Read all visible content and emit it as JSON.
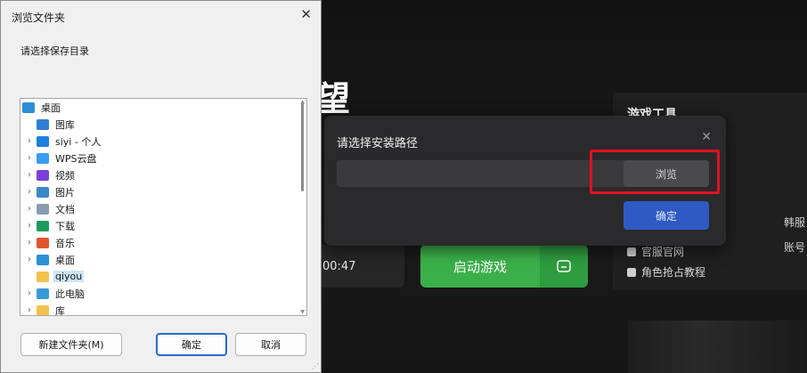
{
  "colors": {
    "accent_blue": "#2f5ac4",
    "start_green": "#3bb04a",
    "highlight_red": "#e0101e",
    "dialog_bg": "#2a2a2c",
    "windows_bg": "#f0f0f0"
  },
  "launcher": {
    "title_partial": "望",
    "time_partial": "00:47",
    "start_button": "启动游戏",
    "folder_icon": "folder-icon",
    "side_panel": {
      "title": "游戏工具",
      "items": [
        {
          "icon": "web-icon",
          "label": "官服官网"
        },
        {
          "icon": "doc-icon",
          "label": "角色抢占教程"
        }
      ],
      "links": [
        "韩服",
        "账号"
      ]
    }
  },
  "install_dialog": {
    "title": "请选择安装路径",
    "path_value": "",
    "browse_label": "浏览",
    "confirm_label": "确定"
  },
  "folder_dialog": {
    "title": "浏览文件夹",
    "prompt": "请选择保存目录",
    "tree": [
      {
        "label": "桌面",
        "icon": "desktop-icon",
        "color": "#2d8fd5",
        "level": 0,
        "expander": false
      },
      {
        "label": "图库",
        "icon": "gallery-icon",
        "color": "#2f7fd0",
        "level": 1,
        "expander": false
      },
      {
        "label": "siyi - 个人",
        "icon": "onedrive-icon",
        "color": "#1f7fdc",
        "level": 1,
        "expander": true
      },
      {
        "label": "WPS云盘",
        "icon": "cloud-icon",
        "color": "#3a9cf0",
        "level": 1,
        "expander": true
      },
      {
        "label": "视频",
        "icon": "video-icon",
        "color": "#7b3fd8",
        "level": 1,
        "expander": true
      },
      {
        "label": "图片",
        "icon": "pictures-icon",
        "color": "#3a86c8",
        "level": 1,
        "expander": true
      },
      {
        "label": "文档",
        "icon": "documents-icon",
        "color": "#8a9bb0",
        "level": 1,
        "expander": true
      },
      {
        "label": "下载",
        "icon": "download-icon",
        "color": "#1d9a5b",
        "level": 1,
        "expander": true
      },
      {
        "label": "音乐",
        "icon": "music-icon",
        "color": "#e0552e",
        "level": 1,
        "expander": true
      },
      {
        "label": "桌面",
        "icon": "desktop-icon",
        "color": "#2d8fd5",
        "level": 1,
        "expander": true
      },
      {
        "label": "qiyou",
        "icon": "folder-icon",
        "color": "#f2c14e",
        "level": 1,
        "expander": false,
        "selected": true
      },
      {
        "label": "此电脑",
        "icon": "computer-icon",
        "color": "#3a9ad8",
        "level": 1,
        "expander": true
      },
      {
        "label": "库",
        "icon": "folder-icon",
        "color": "#f2c14e",
        "level": 1,
        "expander": true
      }
    ],
    "new_folder_button": "新建文件夹(M)",
    "ok_button": "确定",
    "cancel_button": "取消"
  }
}
